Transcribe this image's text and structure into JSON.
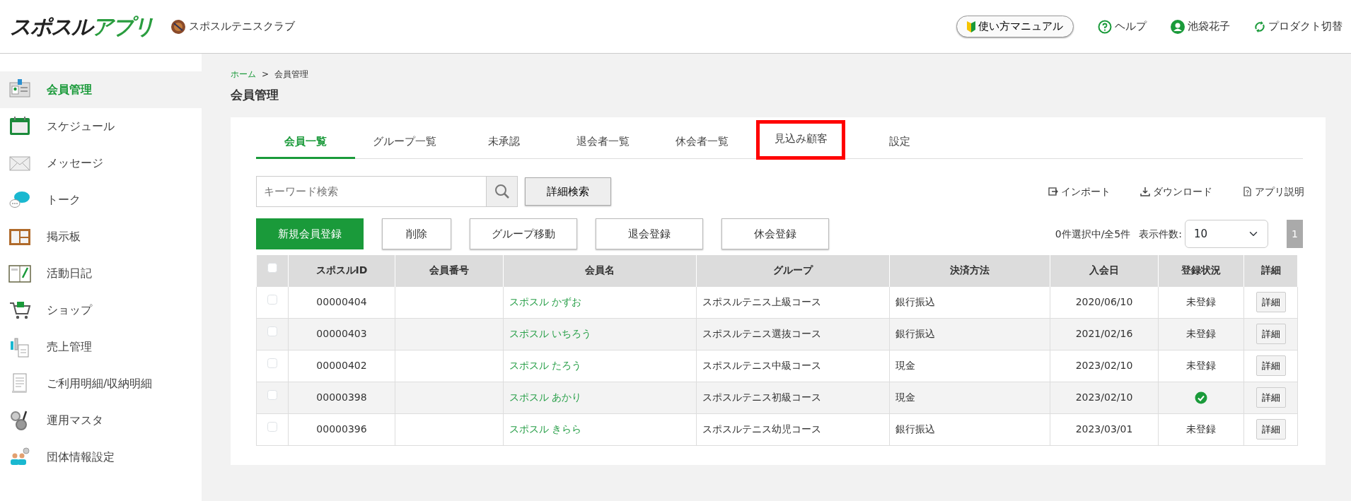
{
  "header": {
    "logo": "スポスルアプリ",
    "club": "スポスルテニスクラブ",
    "manual": "使い方マニュアル",
    "help": "ヘルプ",
    "user": "池袋花子",
    "switch": "プロダクト切替"
  },
  "sidebar": {
    "items": [
      {
        "label": "会員管理",
        "selected": true
      },
      {
        "label": "スケジュール",
        "selected": false
      },
      {
        "label": "メッセージ",
        "selected": false
      },
      {
        "label": "トーク",
        "selected": false
      },
      {
        "label": "掲示板",
        "selected": false
      },
      {
        "label": "活動日記",
        "selected": false
      },
      {
        "label": "ショップ",
        "selected": false
      },
      {
        "label": "売上管理",
        "selected": false
      },
      {
        "label": "ご利用明細/収納明細",
        "selected": false
      },
      {
        "label": "運用マスタ",
        "selected": false
      },
      {
        "label": "団体情報設定",
        "selected": false
      }
    ]
  },
  "breadcrumb": [
    "ホーム",
    "会員管理"
  ],
  "breadcrumb_separator": ">",
  "page_title": "会員管理",
  "tabs": [
    {
      "label": "会員一覧",
      "selected": true,
      "highlighted": false
    },
    {
      "label": "グループ一覧",
      "selected": false,
      "highlighted": false
    },
    {
      "label": "未承認",
      "selected": false,
      "highlighted": false
    },
    {
      "label": "退会者一覧",
      "selected": false,
      "highlighted": false
    },
    {
      "label": "休会者一覧",
      "selected": false,
      "highlighted": false
    },
    {
      "label": "見込み顧客",
      "selected": false,
      "highlighted": true
    },
    {
      "label": "設定",
      "selected": false,
      "highlighted": false
    }
  ],
  "search": {
    "placeholder": "キーワード検索",
    "advanced": "詳細検索"
  },
  "links": [
    "インポート",
    "ダウンロード",
    "アプリ説明"
  ],
  "actions": [
    {
      "label": "新規会員登録",
      "primary": true
    },
    {
      "label": "削除",
      "primary": false
    },
    {
      "label": "グループ移動",
      "primary": false
    },
    {
      "label": "退会登録",
      "primary": false
    },
    {
      "label": "休会登録",
      "primary": false
    }
  ],
  "selection_info": "0件選択中/全5件",
  "page_size": {
    "label": "表示件数:",
    "value": "10"
  },
  "pagination": [
    "1"
  ],
  "table": {
    "select_all_checked": false,
    "columns": [
      "スポスルID",
      "会員番号",
      "会員名",
      "グループ",
      "決済方法",
      "入会日",
      "登録状況",
      "詳細"
    ],
    "rows": [
      {
        "checked": false,
        "id": "00000404",
        "name": "スポスル かずお",
        "group": "スポスルテニス上級コース",
        "payment": "銀行振込",
        "joined": "2020/06/10",
        "registered": false,
        "status": "未登録",
        "detail": "詳細"
      },
      {
        "checked": false,
        "id": "00000403",
        "name": "スポスル いちろう",
        "group": "スポスルテニス選抜コース",
        "payment": "銀行振込",
        "joined": "2021/02/16",
        "registered": false,
        "status": "未登録",
        "detail": "詳細"
      },
      {
        "checked": false,
        "id": "00000402",
        "name": "スポスル たろう",
        "group": "スポスルテニス中級コース",
        "payment": "現金",
        "joined": "2023/02/10",
        "registered": false,
        "status": "未登録",
        "detail": "詳細"
      },
      {
        "checked": false,
        "id": "00000398",
        "name": "スポスル あかり",
        "group": "スポスルテニス初級コース",
        "payment": "現金",
        "joined": "2023/02/10",
        "registered": true,
        "detail": "詳細"
      },
      {
        "checked": false,
        "id": "00000396",
        "name": "スポスル きらら",
        "group": "スポスルテニス幼児コース",
        "payment": "銀行振込",
        "joined": "2023/03/01",
        "registered": false,
        "status": "未登録",
        "detail": "詳細"
      }
    ]
  }
}
